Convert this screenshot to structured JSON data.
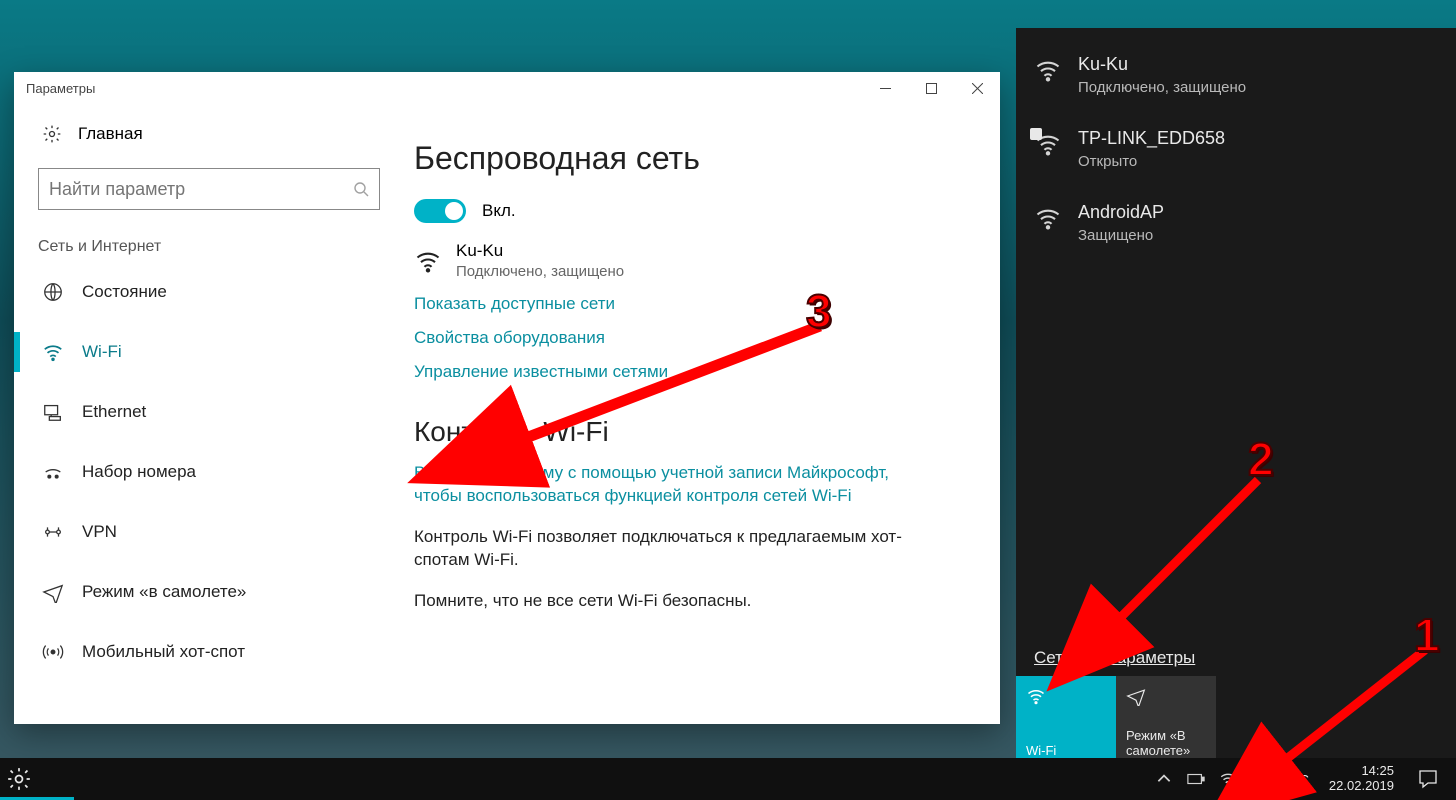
{
  "settings": {
    "title": "Параметры",
    "home": "Главная",
    "search_placeholder": "Найти параметр",
    "category": "Сеть и Интернет",
    "nav": {
      "status": "Состояние",
      "wifi": "Wi-Fi",
      "ethernet": "Ethernet",
      "dialup": "Набор номера",
      "vpn": "VPN",
      "airplane": "Режим «в самолете»",
      "hotspot": "Мобильный хот-спот"
    },
    "content": {
      "h1": "Беспроводная сеть",
      "toggle_label": "Вкл.",
      "ssid": "Ku-Ku",
      "ssid_sub": "Подключено, защищено",
      "link_available": "Показать доступные сети",
      "link_hw": "Свойства оборудования",
      "link_known": "Управление известными сетями",
      "h2": "Контроль Wi-Fi",
      "link_signin": "Войдите в систему с помощью учетной записи Майкрософт, чтобы воспользоваться функцией контроля сетей Wi-Fi",
      "p1": "Контроль Wi-Fi позволяет подключаться к предлагаемым хот-спотам Wi-Fi.",
      "p2": "Помните, что не все сети Wi-Fi безопасны."
    }
  },
  "flyout": {
    "nets": [
      {
        "name": "Ku-Ku",
        "sub": "Подключено, защищено",
        "shield": false
      },
      {
        "name": "TP-LINK_EDD658",
        "sub": "Открыто",
        "shield": true
      },
      {
        "name": "AndroidAP",
        "sub": "Защищено",
        "shield": false
      }
    ],
    "settings_link": "Сетевые параметры",
    "tile_wifi": "Wi-Fi",
    "tile_airplane": "Режим «В самолете»"
  },
  "taskbar": {
    "lang": "РУС",
    "time": "14:25",
    "date": "22.02.2019"
  },
  "annotations": {
    "n1": "1",
    "n2": "2",
    "n3": "3"
  }
}
